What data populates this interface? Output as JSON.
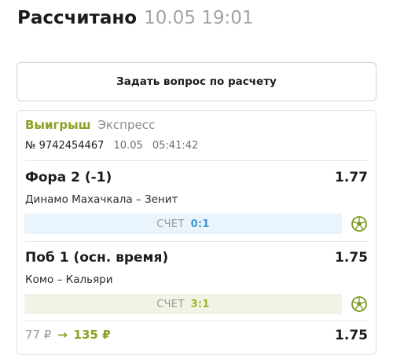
{
  "header": {
    "title": "Рассчитано",
    "datetime": "10.05 19:01"
  },
  "ask_button": {
    "label": "Задать вопрос по расчету"
  },
  "bet": {
    "status": "Выигрыш",
    "type": "Экспресс",
    "number": "№ 9742454467",
    "date": "10.05",
    "time": "05:41:42",
    "events": [
      {
        "market": "Фора 2 (-1)",
        "odds": "1.77",
        "teams": "Динамо Махачкала – Зенит",
        "score_label": "СЧЕТ",
        "score": "0:1",
        "sport_icon": "football-icon"
      },
      {
        "market": "Поб 1 (осн. время)",
        "odds": "1.75",
        "teams": "Комо – Кальяри",
        "score_label": "СЧЕТ",
        "score": "3:1",
        "sport_icon": "football-icon"
      }
    ],
    "stake": "77 ₽",
    "arrow": "→",
    "payout": "135 ₽",
    "total_odds": "1.75"
  },
  "colors": {
    "win": "#8aa224",
    "score_blue": "#3c9bd6",
    "score_green": "#a6b52b",
    "muted": "#a3a3a3"
  }
}
